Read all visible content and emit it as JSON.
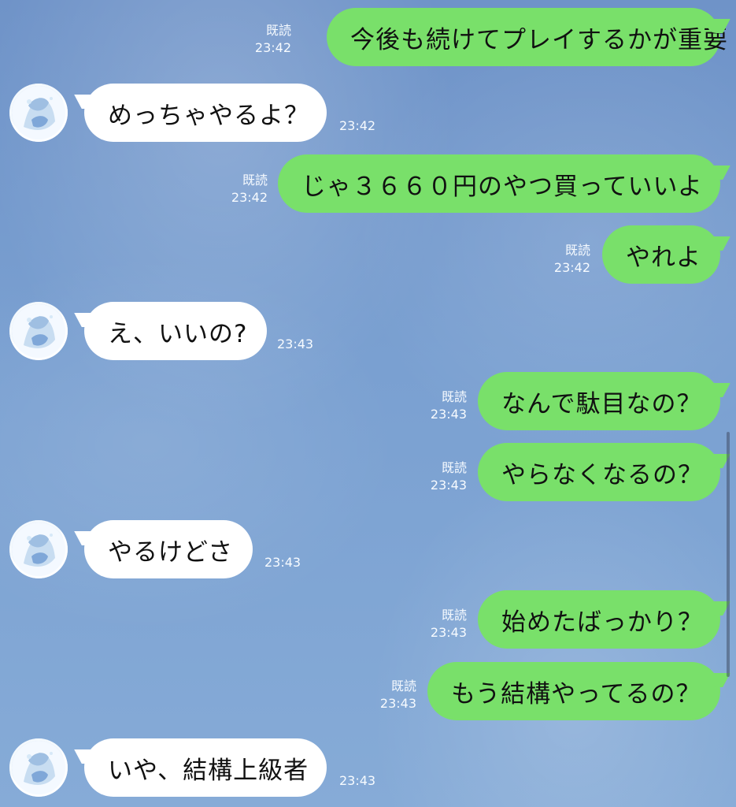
{
  "chat": {
    "messages": [
      {
        "type": "sent",
        "read": "既読",
        "time": "23:42",
        "text": "今後も続けてプレイするかが重要"
      },
      {
        "type": "received",
        "time": "23:42",
        "text": "めっちゃやるよ？"
      },
      {
        "type": "sent",
        "read": "既読",
        "time": "23:42",
        "text": "じゃ３６６０円のやつ買っていいよ"
      },
      {
        "type": "sent",
        "read": "既読",
        "time": "23:42",
        "text": "やれよ"
      },
      {
        "type": "received",
        "time": "23:43",
        "text": "え、いいの?"
      },
      {
        "type": "sent",
        "read": "既読",
        "time": "23:43",
        "text": "なんで駄目なの？"
      },
      {
        "type": "sent",
        "read": "既読",
        "time": "23:43",
        "text": "やらなくなるの？"
      },
      {
        "type": "received",
        "time": "23:43",
        "text": "やるけどさ"
      },
      {
        "type": "sent",
        "read": "既読",
        "time": "23:43",
        "text": "始めたばっかり？"
      },
      {
        "type": "sent",
        "read": "既読",
        "time": "23:43",
        "text": "もう結構やってるの？"
      },
      {
        "type": "received",
        "time": "23:43",
        "text": "いや、結構上級者"
      }
    ]
  },
  "icons": {
    "avatar": "avatar-icon"
  },
  "colors": {
    "sent_bubble": "#79e06a",
    "received_bubble": "#ffffff",
    "background": "#7aa0d1"
  }
}
